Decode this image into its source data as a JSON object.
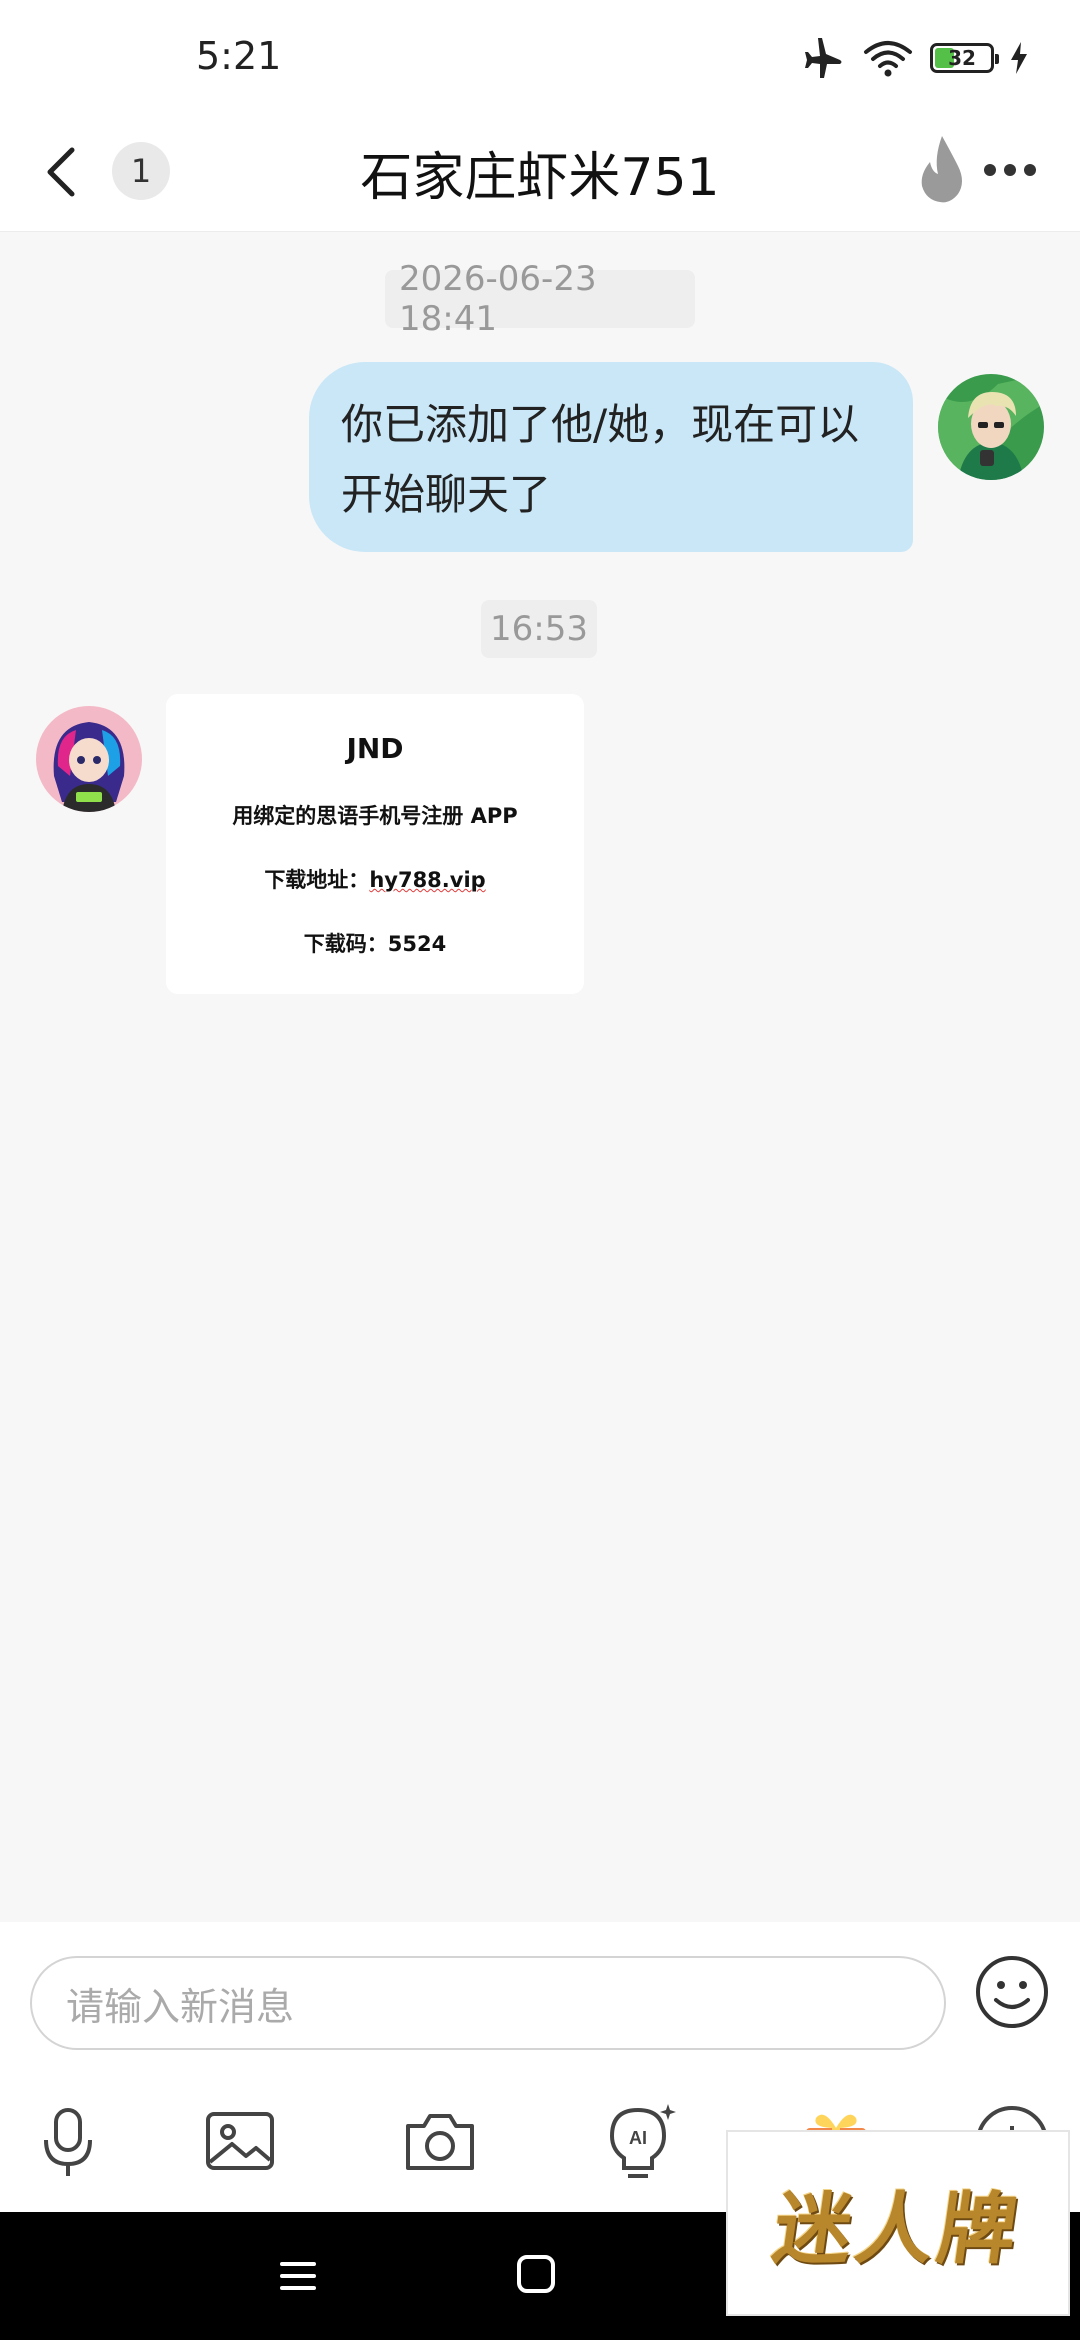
{
  "status_bar": {
    "time": "5:21",
    "battery_level": "32",
    "battery_fraction": 0.32,
    "icons": [
      "airplane-mode-icon",
      "wifi-icon",
      "battery-icon",
      "charging-icon"
    ]
  },
  "header": {
    "unread_count": "1",
    "title": "石家庄虾米751",
    "icons": [
      "back-arrow-icon",
      "flame-icon",
      "more-dots-icon"
    ]
  },
  "chat": {
    "timestamps": [
      "2026-06-23 18:41",
      "16:53"
    ],
    "outgoing_message": "你已添加了他/她，现在可以开始聊天了",
    "image_card": {
      "title": "JND",
      "line1": "用绑定的思语手机号注册 APP",
      "line2_prefix": "下载地址：",
      "line2_link": "hy788.vip",
      "line3": "下载码：5524"
    },
    "bubble_color": "#c9e7f7"
  },
  "input": {
    "placeholder": "请输入新消息",
    "value": "",
    "tools": [
      "microphone-icon",
      "image-icon",
      "camera-icon",
      "ai-assistant-icon",
      "gift-icon",
      "more-circle-icon"
    ]
  },
  "watermark": {
    "text": "迷人牌"
  }
}
